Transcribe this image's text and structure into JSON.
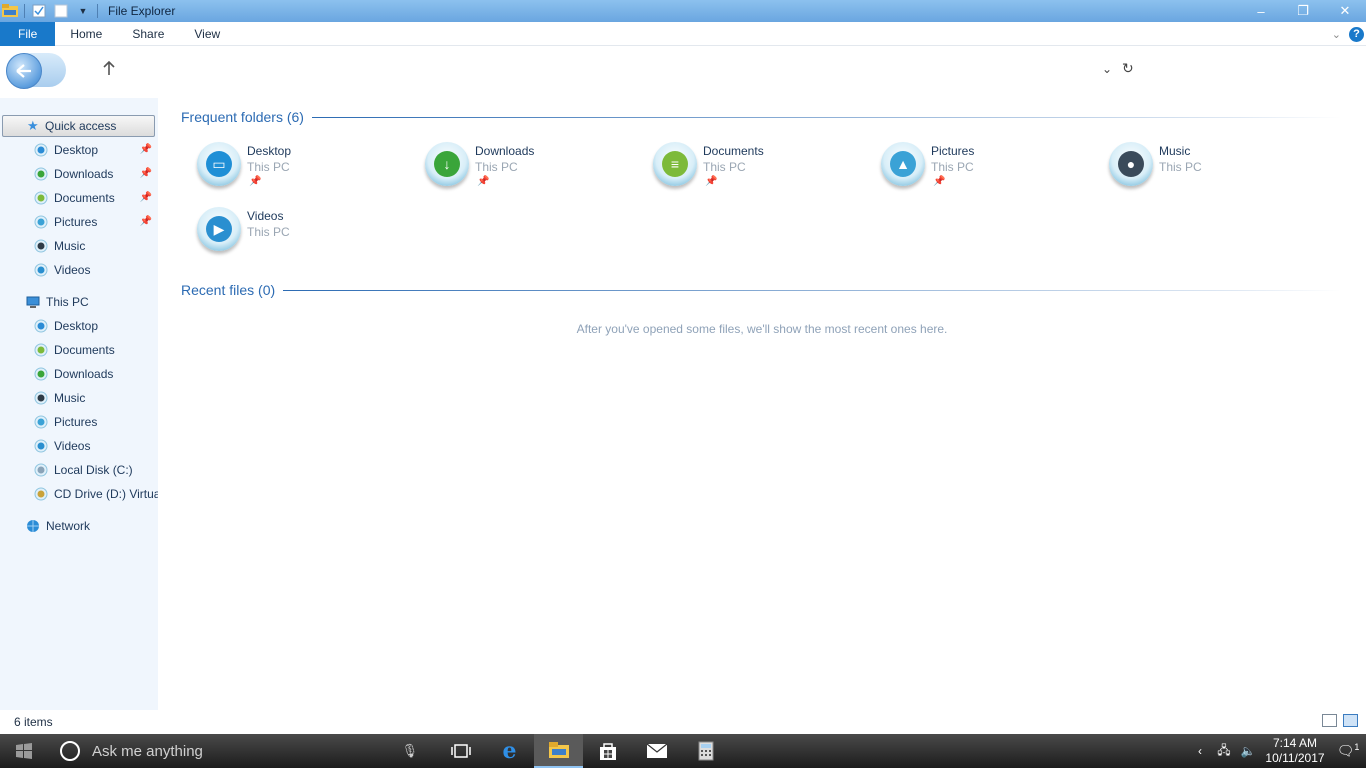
{
  "window": {
    "title": "File Explorer",
    "controls": {
      "minimize": "–",
      "restore": "❐",
      "close": "✕"
    }
  },
  "ribbon": {
    "tabs": [
      {
        "label": "File"
      },
      {
        "label": "Home"
      },
      {
        "label": "Share"
      },
      {
        "label": "View"
      }
    ],
    "help": "?"
  },
  "nav": {
    "quick_access": "Quick access",
    "quick_items": [
      {
        "label": "Desktop",
        "icon": "desktop-icon",
        "pinned": true
      },
      {
        "label": "Downloads",
        "icon": "downloads-icon",
        "pinned": true
      },
      {
        "label": "Documents",
        "icon": "documents-icon",
        "pinned": true
      },
      {
        "label": "Pictures",
        "icon": "pictures-icon",
        "pinned": true
      },
      {
        "label": "Music",
        "icon": "music-icon",
        "pinned": false
      },
      {
        "label": "Videos",
        "icon": "videos-icon",
        "pinned": false
      }
    ],
    "this_pc": "This PC",
    "pc_items": [
      {
        "label": "Desktop",
        "icon": "desktop-icon"
      },
      {
        "label": "Documents",
        "icon": "documents-icon"
      },
      {
        "label": "Downloads",
        "icon": "downloads-icon"
      },
      {
        "label": "Music",
        "icon": "music-icon"
      },
      {
        "label": "Pictures",
        "icon": "pictures-icon"
      },
      {
        "label": "Videos",
        "icon": "videos-icon"
      },
      {
        "label": "Local Disk (C:)",
        "icon": "disk-icon"
      },
      {
        "label": "CD Drive (D:) Virtua",
        "icon": "cd-drive-icon"
      }
    ],
    "network": "Network"
  },
  "content": {
    "frequent_title": "Frequent folders (6)",
    "folders": [
      {
        "name": "Desktop",
        "location": "This PC",
        "pinned": true,
        "icon": "desktop-folder-icon",
        "color": "#1f8fd6"
      },
      {
        "name": "Downloads",
        "location": "This PC",
        "pinned": true,
        "icon": "downloads-folder-icon",
        "color": "#3aa53a"
      },
      {
        "name": "Documents",
        "location": "This PC",
        "pinned": true,
        "icon": "documents-folder-icon",
        "color": "#7dba3a"
      },
      {
        "name": "Pictures",
        "location": "This PC",
        "pinned": true,
        "icon": "pictures-folder-icon",
        "color": "#3ba2d6"
      },
      {
        "name": "Music",
        "location": "This PC",
        "pinned": false,
        "icon": "music-folder-icon",
        "color": "#3a4a5a"
      },
      {
        "name": "Videos",
        "location": "This PC",
        "pinned": false,
        "icon": "videos-folder-icon",
        "color": "#2a8fd0"
      }
    ],
    "recent_title": "Recent files (0)",
    "recent_empty": "After you've opened some files, we'll show the most recent ones here."
  },
  "status": {
    "item_count": "6 items"
  },
  "taskbar": {
    "search_placeholder": "Ask me anything",
    "time": "7:14 AM",
    "date": "10/11/2017",
    "notification_count": "1"
  }
}
